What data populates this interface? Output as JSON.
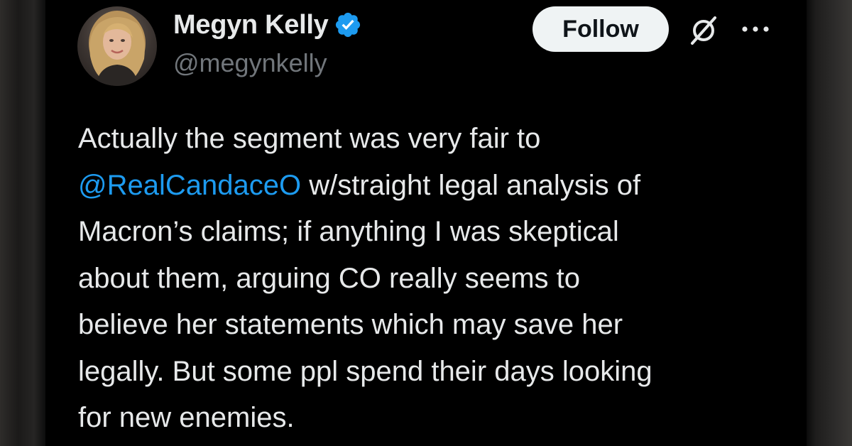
{
  "tweet": {
    "author": {
      "display_name": "Megyn Kelly",
      "handle": "@megynkelly",
      "verified": true,
      "verified_badge_color": "#1d9bf0",
      "avatar": "profile-photo"
    },
    "actions": {
      "follow_label": "Follow",
      "grok_icon": "grok-icon",
      "more_icon": "more-options-icon"
    },
    "lines": [
      {
        "text": "Actually the segment was very fair to"
      },
      {
        "mention": "@RealCandaceO",
        "text": " w/straight legal analysis of"
      },
      {
        "text": "Macron’s claims; if anything I was skeptical"
      },
      {
        "text": "about them, arguing CO really seems to"
      },
      {
        "text": "believe her statements which may save her"
      },
      {
        "text": "legally. But some ppl spend their days looking"
      },
      {
        "text": "for new enemies."
      }
    ]
  },
  "colors": {
    "background": "#000000",
    "text": "#e7e9ea",
    "secondary_text": "#71767b",
    "mention": "#1d9bf0",
    "button_bg": "#eff3f4"
  }
}
